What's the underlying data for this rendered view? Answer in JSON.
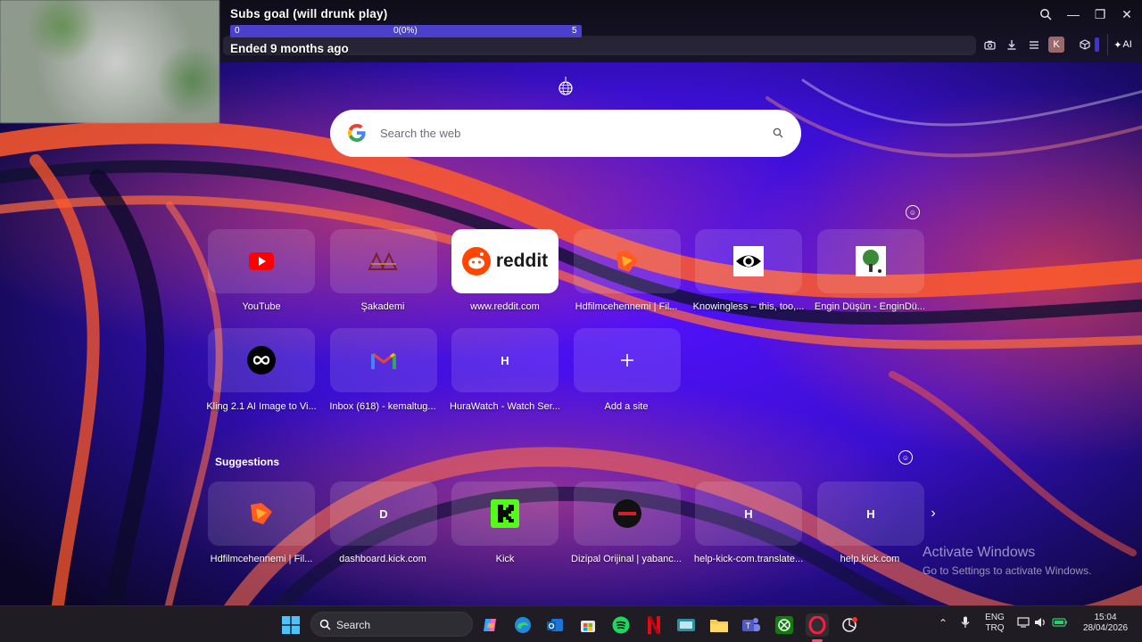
{
  "stream_overlay": {
    "goal_title": "Subs goal (will drunk play)",
    "goal_start": "0",
    "goal_progress_label": "0(0%)",
    "goal_end": "5",
    "goal_progress": 0,
    "goal_status": "Ended 9 months ago"
  },
  "toolbar": {
    "profile_letter": "K",
    "ai_label": "AI"
  },
  "search": {
    "placeholder": "Search the web"
  },
  "speed_dial": [
    {
      "label": "YouTube",
      "icon": "youtube-icon"
    },
    {
      "label": "Şakademi",
      "icon": "sakademi-logo-icon"
    },
    {
      "label": "www.reddit.com",
      "icon": "reddit-logo-icon",
      "logo_text": "reddit"
    },
    {
      "label": "Hdfilmcehennemi | Fil...",
      "icon": "hdfilm-logo-icon"
    },
    {
      "label": "Knowingless – this, too,...",
      "icon": "eye-logo-icon"
    },
    {
      "label": "Engin Düşün - EnginDü...",
      "icon": "tree-logo-icon"
    },
    {
      "label": "Kling 2.1 AI Image to Vi...",
      "icon": "kling-infinity-icon"
    },
    {
      "label": "Inbox (618) - kemaltug...",
      "icon": "gmail-icon"
    },
    {
      "label": "HuraWatch - Watch Ser...",
      "icon": "letter-icon",
      "letter": "H"
    },
    {
      "label": "Add a site",
      "icon": "plus-icon"
    }
  ],
  "suggestions_title": "Suggestions",
  "suggestions": [
    {
      "label": "Hdfilmcehennemi | Fil...",
      "icon": "hdfilm-logo-icon"
    },
    {
      "label": "dashboard.kick.com",
      "icon": "letter-icon",
      "letter": "D"
    },
    {
      "label": "Kick",
      "icon": "kick-logo-icon"
    },
    {
      "label": "Dizipal Orijinal | yabanc...",
      "icon": "dizipal-logo-icon"
    },
    {
      "label": "help-kick-com.translate...",
      "icon": "letter-icon",
      "letter": "H"
    },
    {
      "label": "help.kick.com",
      "icon": "letter-icon",
      "letter": "H"
    }
  ],
  "watermark": {
    "title": "Activate Windows",
    "subtitle": "Go to Settings to activate Windows."
  },
  "taskbar": {
    "search_label": "Search",
    "lang_top": "ENG",
    "lang_bottom": "TRQ",
    "time": "15:04",
    "date": "28/04/2026"
  },
  "colors": {
    "accent": "#5b3cff",
    "reddit_orange": "#ff4500",
    "kick_green": "#53fc18",
    "youtube_red": "#ff0000"
  }
}
